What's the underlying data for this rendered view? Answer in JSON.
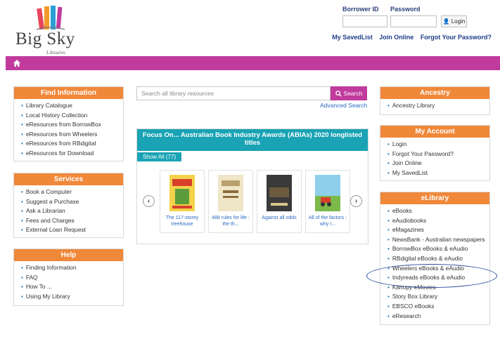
{
  "logo": {
    "name": "Big Sky",
    "sub": "Libraries",
    "icon": "books-logo-icon"
  },
  "login": {
    "borrower_label": "Borrower ID",
    "password_label": "Password",
    "login_button": "Login",
    "links": [
      "My SavedList",
      "Join Online",
      "Forgot Your Password?"
    ]
  },
  "nav": {
    "home_icon": "home-icon",
    "color": "#c03b9d"
  },
  "find_info": {
    "title": "Find Information",
    "items": [
      "Library Catalogue",
      "Local History Collection",
      "eResources from BorrowBox",
      "eResources from Wheelers",
      "eResources from RBdigital",
      "eResources for Download"
    ]
  },
  "services": {
    "title": "Services",
    "items": [
      "Book a Computer",
      "Suggest a Purchase",
      "Ask a Librarian",
      "Fees and Charges",
      "External Loan Request"
    ]
  },
  "help": {
    "title": "Help",
    "items": [
      "Finding Information",
      "FAQ",
      "How To ...",
      "Using My Library"
    ]
  },
  "search": {
    "placeholder": "Search all library resources",
    "button": "Search",
    "advanced": "Advanced Search"
  },
  "focus": {
    "title": "Focus On... Australian Book Industry Awards (ABIAs) 2020 longlisted titles",
    "show_all": "Show All (77)",
    "books": [
      {
        "title": "The 117-storey treehouse"
      },
      {
        "title": "488 rules for life : the th..."
      },
      {
        "title": "Against all odds"
      },
      {
        "title": "All of the factors : why I..."
      }
    ]
  },
  "ancestry": {
    "title": "Ancestry",
    "items": [
      "Ancestry Library"
    ]
  },
  "my_account": {
    "title": "My Account",
    "items": [
      "Login",
      "Forgot Your Password?",
      "Join Online",
      "My SavedList"
    ]
  },
  "elibrary": {
    "title": "eLibrary",
    "items": [
      "eBooks",
      "eAudiobooks",
      "eMagazines",
      "NewsBank - Australian newspapers",
      "BorrowBox eBooks & eAudio",
      "RBdigital eBooks & eAudio",
      "Wheelers eBooks & eAudio",
      "Indyreads eBooks & eAudio",
      "Kanopy eMovies",
      "Story Box Library",
      "EBSCO eBooks",
      "eResearch"
    ]
  },
  "colors": {
    "accent_orange": "#f0883a",
    "magenta": "#c03b9d",
    "teal": "#19a3b4",
    "link": "#1f3c88"
  }
}
